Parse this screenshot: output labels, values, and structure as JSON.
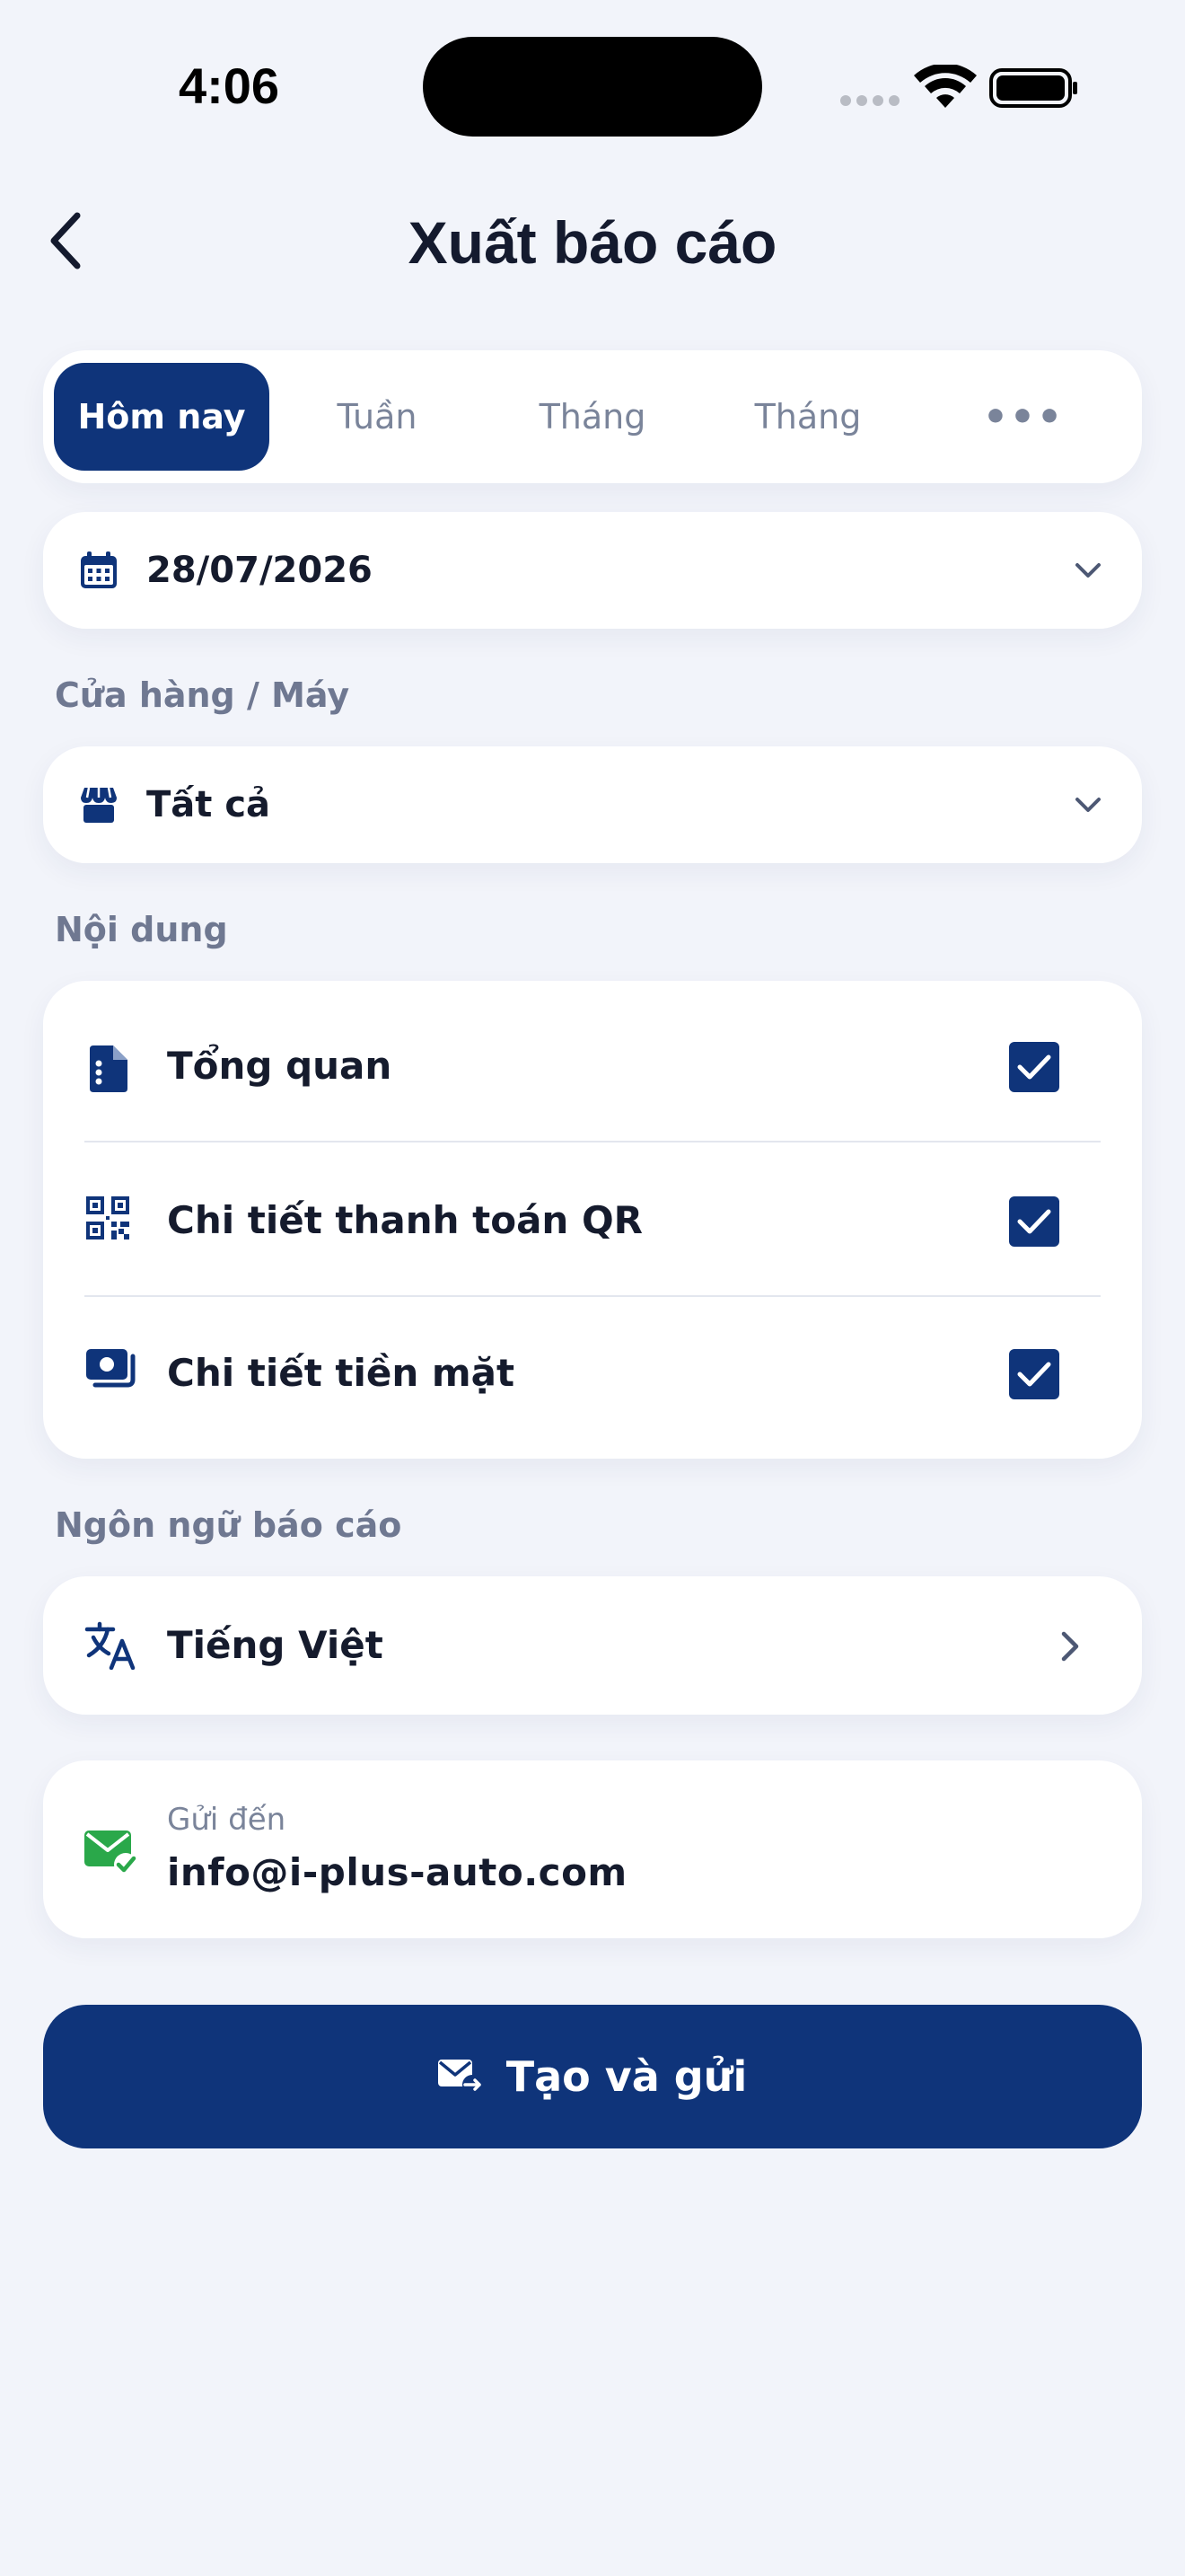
{
  "status_bar": {
    "time": "4:06"
  },
  "header": {
    "title": "Xuất báo cáo"
  },
  "tabs": [
    {
      "label": "Hôm nay",
      "active": true
    },
    {
      "label": "Tuần",
      "active": false
    },
    {
      "label": "Tháng",
      "active": false
    },
    {
      "label": "Tháng",
      "active": false
    },
    {
      "label": "•••",
      "active": false
    }
  ],
  "date_select": {
    "value": "28/07/2026",
    "icon": "calendar-icon"
  },
  "store_section": {
    "label": "Cửa hàng / Máy",
    "value": "Tất cả",
    "icon": "store-icon"
  },
  "content_section": {
    "label": "Nội dung",
    "items": [
      {
        "label": "Tổng quan",
        "icon": "document-icon",
        "checked": true
      },
      {
        "label": "Chi tiết thanh toán QR",
        "icon": "qr-code-icon",
        "checked": true
      },
      {
        "label": "Chi tiết tiền mặt",
        "icon": "cash-icon",
        "checked": true
      }
    ]
  },
  "language_section": {
    "label": "Ngôn ngữ báo cáo",
    "value": "Tiếng Việt",
    "icon": "translate-icon"
  },
  "email": {
    "caption": "Gửi đến",
    "value": "info@i-plus-auto.com",
    "icon": "mail-check-icon"
  },
  "submit": {
    "label": "Tạo và gửi",
    "icon": "send-mail-icon"
  },
  "colors": {
    "primary": "#0f347a",
    "background": "#f2f4fa",
    "success": "#2aa84a",
    "muted": "#7a849a"
  }
}
